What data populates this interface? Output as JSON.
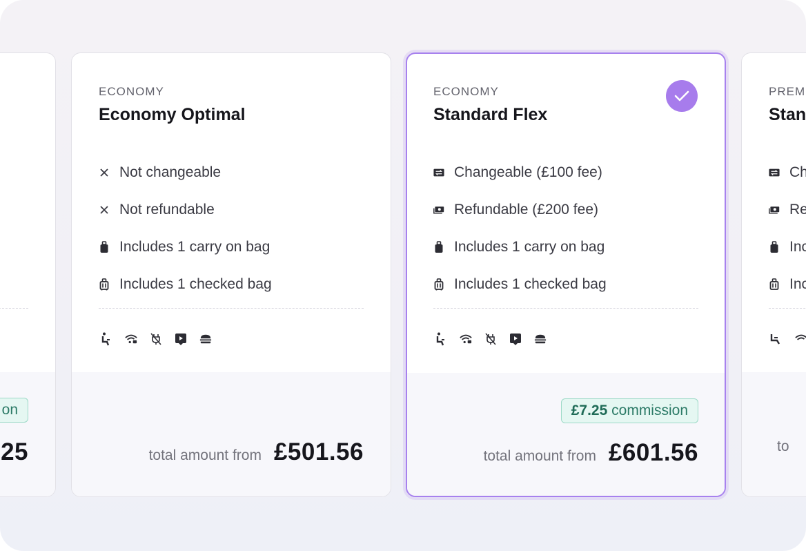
{
  "cards": [
    {
      "badge_partial": "on",
      "amount_partial": "25"
    },
    {
      "cabin": "ECONOMY",
      "name": "Economy Optimal",
      "features": [
        {
          "icon": "close-icon",
          "text": "Not changeable"
        },
        {
          "icon": "close-icon",
          "text": "Not refundable"
        },
        {
          "icon": "carry-on-bag-icon",
          "text": "Includes 1 carry on bag"
        },
        {
          "icon": "checked-bag-icon",
          "text": "Includes 1 checked bag"
        }
      ],
      "amenities": [
        "seat-icon",
        "wifi-icon",
        "no-power-icon",
        "entertainment-icon",
        "meal-icon"
      ],
      "total_label": "total amount from",
      "total_amount": "£501.56",
      "selected": false
    },
    {
      "cabin": "ECONOMY",
      "name": "Standard Flex",
      "features": [
        {
          "icon": "ticket-change-icon",
          "text": "Changeable (£100 fee)"
        },
        {
          "icon": "money-refund-icon",
          "text": "Refundable (£200 fee)"
        },
        {
          "icon": "carry-on-bag-icon",
          "text": "Includes 1 carry on bag"
        },
        {
          "icon": "checked-bag-icon",
          "text": "Includes 1 checked bag"
        }
      ],
      "amenities": [
        "seat-icon",
        "wifi-icon",
        "no-power-icon",
        "entertainment-icon",
        "meal-icon"
      ],
      "commission_amount": "£7.25",
      "commission_label": "commission",
      "total_label": "total amount from",
      "total_amount": "£601.56",
      "selected": true,
      "check_icon": "check-icon"
    },
    {
      "cabin_partial": "PREM",
      "name_partial": "Stan",
      "features_partial": [
        "Ch",
        "Re",
        "Inc",
        "Inc"
      ],
      "total_label_partial": "to"
    }
  ],
  "colors": {
    "accent": "#a77cec",
    "commission_bg": "#e5f7f2",
    "commission_text": "#2b7a66"
  }
}
